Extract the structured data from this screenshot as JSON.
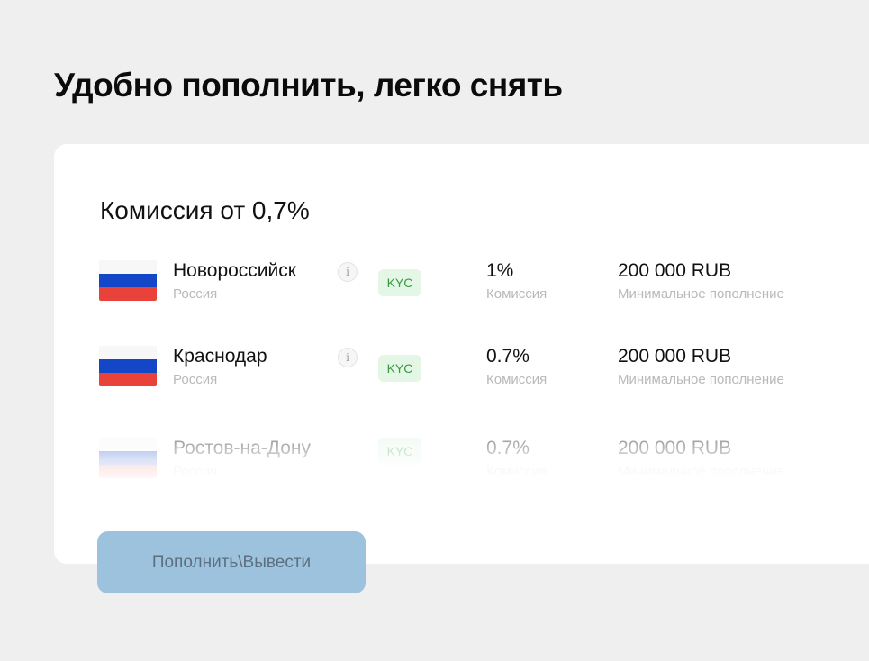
{
  "heading": "Удобно пополнить, легко снять",
  "card": {
    "title": "Комиссия от 0,7%",
    "rows": [
      {
        "city": "Новороссийск",
        "country": "Россия",
        "badge": "KYC",
        "info": "i",
        "fee": "1%",
        "fee_label": "Комиссия",
        "min": "200 000 RUB",
        "min_label": "Минимальное пополнение",
        "flag": "russia-flag"
      },
      {
        "city": "Краснодар",
        "country": "Россия",
        "badge": "KYC",
        "info": "i",
        "fee": "0.7%",
        "fee_label": "Комиссия",
        "min": "200 000 RUB",
        "min_label": "Минимальное пополнение",
        "flag": "russia-flag"
      },
      {
        "city": "Ростов-на-Дону",
        "country": "Россия",
        "badge": "KYC",
        "fee": "0.7%",
        "fee_label": "Комиссия",
        "min": "200 000 RUB",
        "min_label": "Минимальное пополнение",
        "flag": "russia-flag"
      }
    ]
  },
  "cta": {
    "label": "Пополнить\\Вывести"
  },
  "colors": {
    "background": "#efefef",
    "card": "#ffffff",
    "badge_bg": "#e4f6e5",
    "badge_text": "#3a9a44",
    "cta_bg": "#9cc2de",
    "cta_text": "#5c6f80"
  }
}
